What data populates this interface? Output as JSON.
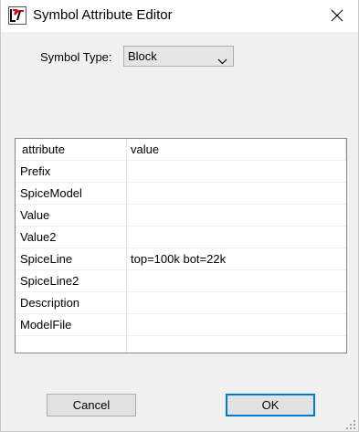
{
  "window": {
    "title": "Symbol Attribute Editor",
    "icon": "ltspice-app-icon",
    "close_icon": "close-icon"
  },
  "symbol_type": {
    "label": "Symbol Type:",
    "selected": "Block"
  },
  "table": {
    "headers": {
      "attribute": "attribute",
      "value": "value"
    },
    "rows": [
      {
        "attribute": "Prefix",
        "value": ""
      },
      {
        "attribute": "SpiceModel",
        "value": ""
      },
      {
        "attribute": "Value",
        "value": ""
      },
      {
        "attribute": "Value2",
        "value": ""
      },
      {
        "attribute": "SpiceLine",
        "value": "top=100k bot=22k"
      },
      {
        "attribute": "SpiceLine2",
        "value": ""
      },
      {
        "attribute": "Description",
        "value": ""
      },
      {
        "attribute": "ModelFile",
        "value": ""
      },
      {
        "attribute": "",
        "value": ""
      }
    ]
  },
  "buttons": {
    "cancel": "Cancel",
    "ok": "OK"
  },
  "colors": {
    "dialog_bg": "#f0f0f0",
    "titlebar_bg": "#ffffff",
    "default_button_border": "#0078d7",
    "app_icon_red": "#d01010"
  }
}
